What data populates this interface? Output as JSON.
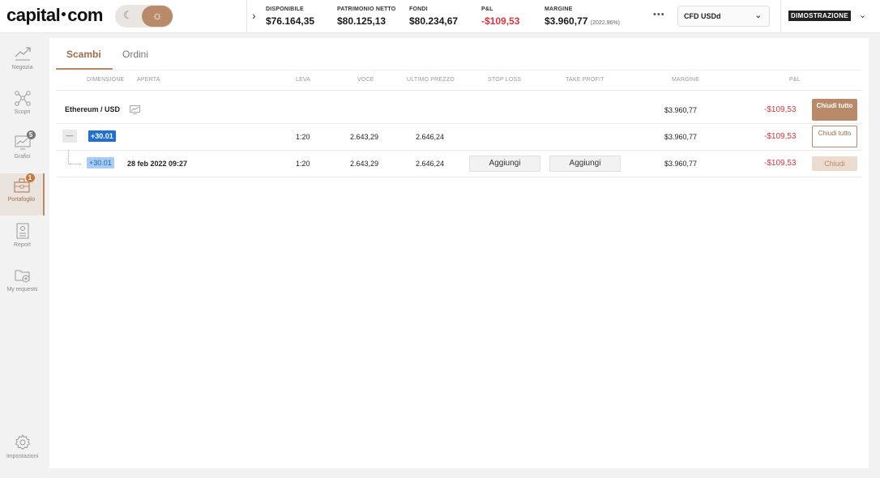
{
  "brand": {
    "logo_left": "capital",
    "logo_right": "com"
  },
  "colors": {
    "accent": "#b88a6a",
    "negative": "#d9363e",
    "position_blue": "#1f6fd6"
  },
  "account_stats": [
    {
      "label": "DISPONIBILE",
      "value": "$76.164,35",
      "negative": false,
      "extra": ""
    },
    {
      "label": "PATRIMONIO NETTO",
      "value": "$80.125,13",
      "negative": false,
      "extra": ""
    },
    {
      "label": "FONDI",
      "value": "$80.234,67",
      "negative": false,
      "extra": ""
    },
    {
      "label": "P&L",
      "value": "-$109,53",
      "negative": true,
      "extra": ""
    },
    {
      "label": "MARGINE",
      "value": "$3.960,77",
      "negative": false,
      "extra": "(2022.96%)"
    }
  ],
  "account_select": {
    "value": "CFD USDd"
  },
  "demo_label": "DIMOSTRAZIONE",
  "sidebar": [
    {
      "label": "Negozia",
      "icon": "trend-icon",
      "badge": ""
    },
    {
      "label": "Scopri",
      "icon": "network-icon",
      "badge": ""
    },
    {
      "label": "Grafici",
      "icon": "chart-monitor-icon",
      "badge": "5"
    },
    {
      "label": "Portafoglio",
      "icon": "briefcase-icon",
      "badge": "1",
      "active": true
    },
    {
      "label": "Report",
      "icon": "report-icon",
      "badge": ""
    },
    {
      "label": "My requests",
      "icon": "folder-add-icon",
      "badge": ""
    },
    {
      "label": "Impostazioni",
      "icon": "gear-icon",
      "badge": ""
    }
  ],
  "tabs": [
    {
      "label": "Scambi",
      "active": true
    },
    {
      "label": "Ordini",
      "active": false
    }
  ],
  "columns": [
    "DIMENSIONE",
    "APERTA",
    "LEVA",
    "VOCE",
    "ULTIMO PREZZO",
    "STOP LOSS",
    "TAKE PROFIT",
    "MARGINE",
    "P&L"
  ],
  "group": {
    "instrument": "Ethereum / USD",
    "margin": "$3.960,77",
    "pnl": "-$109,53",
    "close_all_label": "Chiudi tutto"
  },
  "aggregate_row": {
    "collapse_symbol": "—",
    "size": "+30.01",
    "leverage": "1:20",
    "entry": "2.643,29",
    "last_price": "2.646,24",
    "margin": "$3.960,77",
    "pnl": "-$109,53",
    "close_all_label": "Chiudi tutto"
  },
  "position_row": {
    "size": "+30.01",
    "opened": "28 feb 2022 09:27",
    "leverage": "1:20",
    "entry": "2.643,29",
    "last_price": "2.646,24",
    "stop_loss_label": "Aggiungi",
    "take_profit_label": "Aggiungi",
    "margin": "$3.960,77",
    "pnl": "-$109,53",
    "close_label": "Chiudi"
  }
}
